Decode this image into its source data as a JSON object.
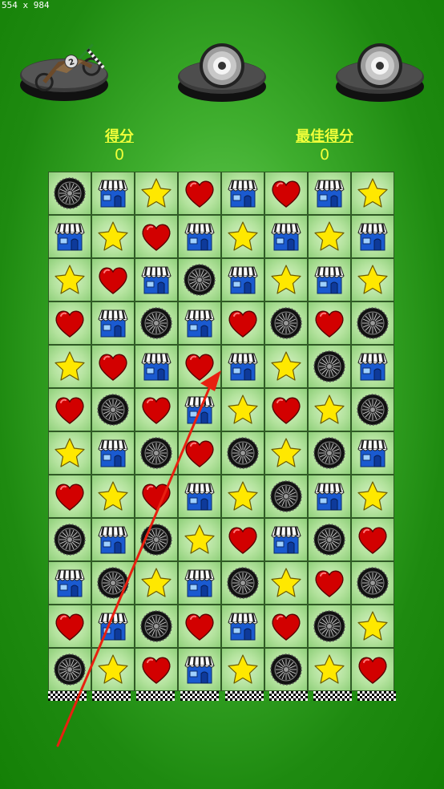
{
  "screen_size_label": "554 x 984",
  "powerups": [
    {
      "name": "race-bike",
      "icon": "bike-icon",
      "badge": "2"
    },
    {
      "name": "empty-slot",
      "icon": "eye-orb-icon",
      "badge": ""
    },
    {
      "name": "empty-slot",
      "icon": "eye-orb-icon",
      "badge": ""
    }
  ],
  "score": {
    "label": "得分",
    "value": "0"
  },
  "best_score": {
    "label": "最佳得分",
    "value": "0"
  },
  "colors": {
    "score_text": "#f0ff3a",
    "heart": "#d20000",
    "star": "#ffe800",
    "shop_blue": "#1a5ad0",
    "arrow": "#e82010"
  },
  "board": {
    "rows": 12,
    "cols": 8,
    "tile_types": {
      "W": "wheel-icon",
      "S": "shop-icon",
      "T": "star-icon",
      "H": "heart-icon"
    },
    "grid": [
      [
        "W",
        "S",
        "T",
        "H",
        "S",
        "H",
        "S",
        "T"
      ],
      [
        "S",
        "T",
        "H",
        "S",
        "T",
        "S",
        "T",
        "S"
      ],
      [
        "T",
        "H",
        "S",
        "W",
        "S",
        "T",
        "S",
        "T"
      ],
      [
        "H",
        "S",
        "W",
        "S",
        "H",
        "W",
        "H",
        "W"
      ],
      [
        "T",
        "H",
        "S",
        "H",
        "S",
        "T",
        "W",
        "S"
      ],
      [
        "H",
        "W",
        "H",
        "S",
        "T",
        "H",
        "T",
        "W"
      ],
      [
        "T",
        "S",
        "W",
        "H",
        "W",
        "T",
        "W",
        "S"
      ],
      [
        "H",
        "T",
        "H",
        "S",
        "T",
        "W",
        "S",
        "T"
      ],
      [
        "W",
        "S",
        "W",
        "T",
        "H",
        "S",
        "W",
        "H"
      ],
      [
        "S",
        "W",
        "T",
        "S",
        "W",
        "T",
        "H",
        "W"
      ],
      [
        "H",
        "S",
        "W",
        "H",
        "S",
        "H",
        "W",
        "T"
      ],
      [
        "W",
        "T",
        "H",
        "S",
        "T",
        "W",
        "T",
        "H"
      ]
    ]
  },
  "finish_flags": 8,
  "hint": {
    "type": "swipe-arrow",
    "direction": "up-right"
  }
}
